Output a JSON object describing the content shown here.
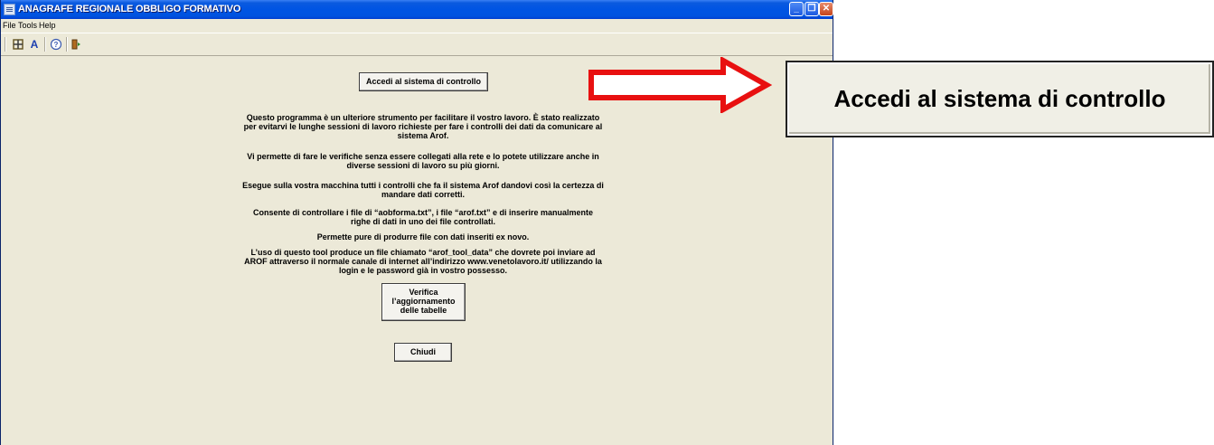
{
  "window": {
    "title": "ANAGRAFE REGIONALE OBBLIGO FORMATIVO",
    "controls": {
      "minimize": "_",
      "maximize": "❐",
      "close": "✕"
    }
  },
  "menu": [
    "File",
    "Tools",
    "Help"
  ],
  "toolbar": {
    "icons": [
      "tools-icon",
      "font-icon",
      "help-icon",
      "exit-icon"
    ]
  },
  "main": {
    "access_button": "Accedi al sistema di controllo",
    "paragraphs": [
      "Questo programma è un ulteriore strumento per facilitare il vostro lavoro. È stato realizzato per evitarvi le lunghe sessioni di lavoro richieste per fare i controlli dei dati da comunicare al sistema Arof.",
      "Vi permette di fare le verifiche senza essere collegati alla rete e lo potete utilizzare anche in diverse sessioni di lavoro su più giorni.",
      "Esegue sulla vostra macchina tutti i controlli che fa il sistema Arof dandovi così la certezza di mandare dati corretti.",
      "Consente di controllare i file di “aobforma.txt”, i file “arof.txt” e di inserire manualmente righe di dati in uno dei file controllati.",
      "Permette pure di produrre file con dati inseriti ex novo.",
      "L’uso di questo tool produce un file chiamato “arof_tool_data” che dovrete poi inviare ad AROF attraverso il normale canale di internet all’indirizzo www.venetolavoro.it/ utilizzando la login e le password già in vostro possesso."
    ],
    "update_button": "Verifica l’aggiornamento delle tabelle",
    "close_button": "Chiudi"
  },
  "callout": {
    "zoomed_label": "Accedi al sistema di controllo",
    "arrow_color": "#e81010"
  }
}
